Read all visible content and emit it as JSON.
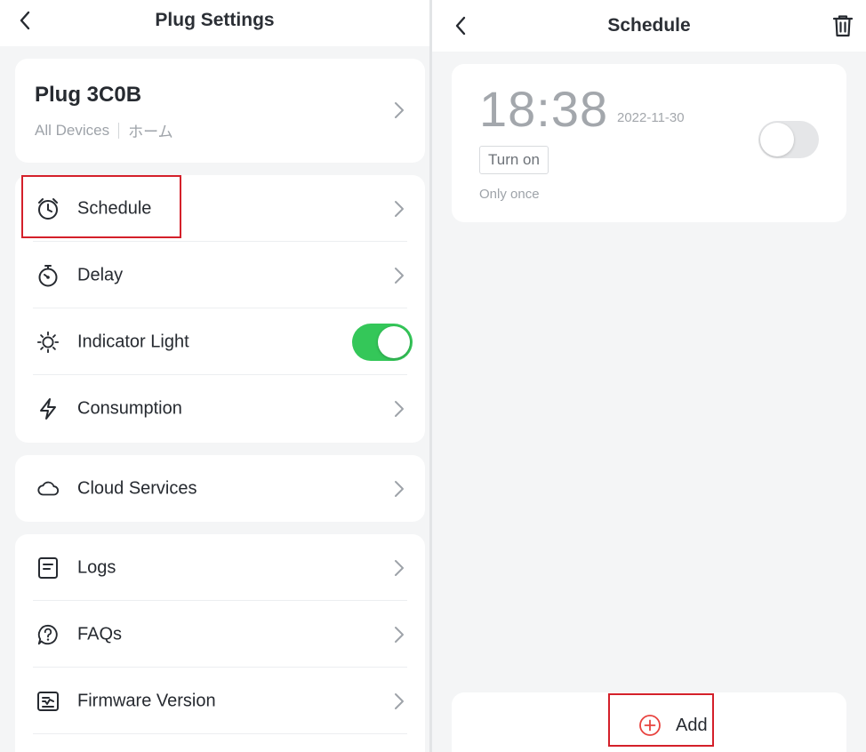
{
  "left": {
    "title": "Plug Settings",
    "device": {
      "name": "Plug 3C0B",
      "group": "All Devices",
      "room": "ホーム"
    },
    "group1": [
      {
        "label": "Schedule",
        "icon": "alarm-clock-icon",
        "type": "link"
      },
      {
        "label": "Delay",
        "icon": "stopwatch-icon",
        "type": "link"
      },
      {
        "label": "Indicator Light",
        "icon": "sun-icon",
        "type": "toggle",
        "value": true
      },
      {
        "label": "Consumption",
        "icon": "lightning-bolt-icon",
        "type": "link"
      }
    ],
    "group2": [
      {
        "label": "Cloud Services",
        "icon": "cloud-icon",
        "type": "link"
      }
    ],
    "group3": [
      {
        "label": "Logs",
        "icon": "document-icon",
        "type": "link"
      },
      {
        "label": "FAQs",
        "icon": "question-bubble-icon",
        "type": "link"
      },
      {
        "label": "Firmware Version",
        "icon": "firmware-icon",
        "type": "link"
      }
    ]
  },
  "right": {
    "title": "Schedule",
    "schedules": [
      {
        "time": "18:38",
        "date": "2022-11-30",
        "action": "Turn on",
        "repeat": "Only once",
        "enabled": false
      }
    ],
    "add_label": "Add"
  },
  "colors": {
    "accent_green": "#34c759",
    "highlight_red": "#d4202a",
    "background": "#f4f5f6",
    "text_primary": "#262a30",
    "text_secondary": "#9ea3a9"
  }
}
